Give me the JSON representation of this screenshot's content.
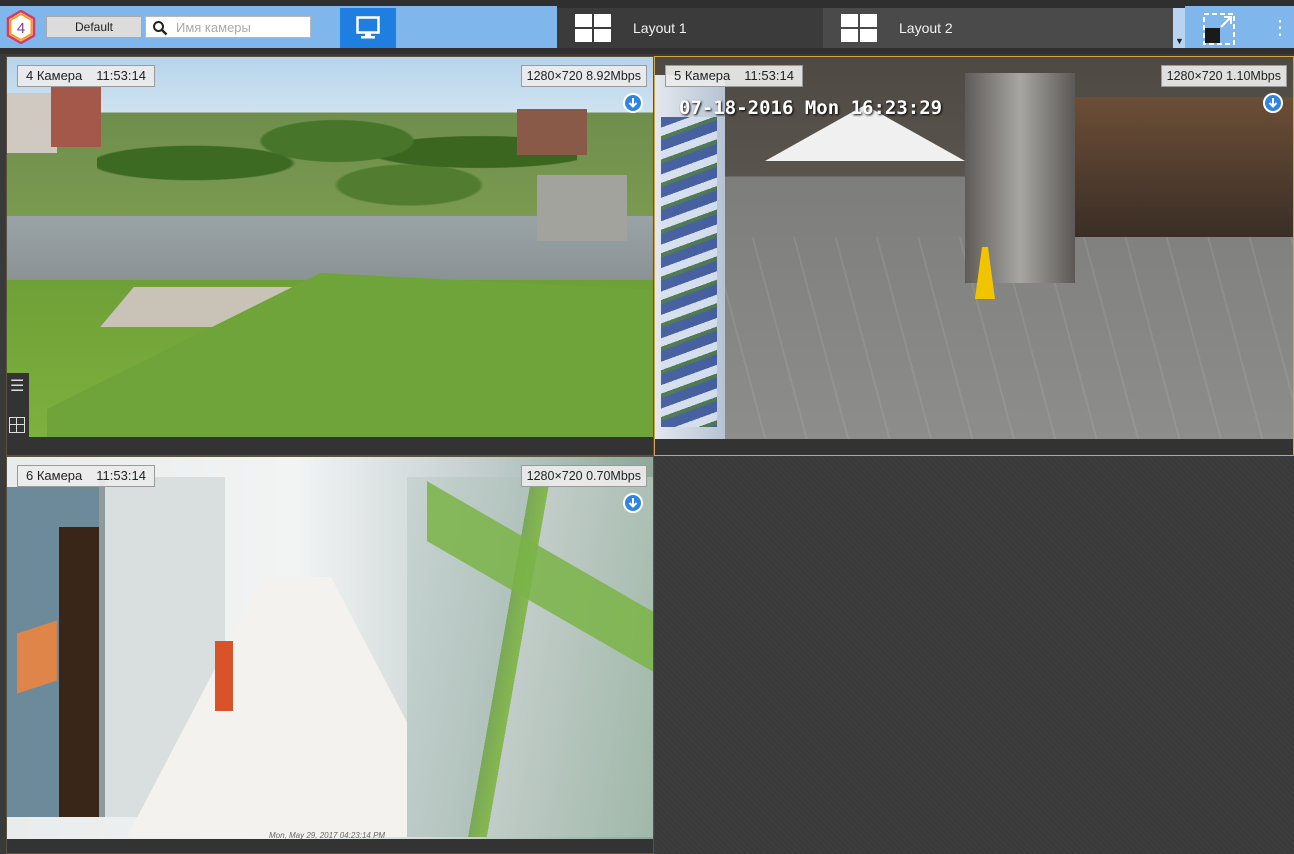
{
  "toolbar": {
    "logo_text": "4",
    "default_label": "Default",
    "search_placeholder": "Имя камеры",
    "search_value": "",
    "tabs": [
      {
        "label": "Layout 1"
      },
      {
        "label": "Layout 2"
      }
    ],
    "colors": {
      "accent": "#1f7fe0",
      "strip": "#7fb6ec",
      "active_border": "#d4a54a"
    },
    "icons": [
      "search-icon",
      "monitor-icon",
      "layout-grid-icon",
      "fullscreen-icon",
      "more-icon"
    ]
  },
  "cameras": [
    {
      "name": "4 Камера",
      "time": "11:53:14",
      "stream": "1280×720 8.92Mbps",
      "scene": "park"
    },
    {
      "name": "5 Камера",
      "time": "11:53:14",
      "stream": "1280×720 1.10Mbps",
      "scene": "lobby",
      "osd": "07-18-2016 Mon 16:23:29"
    },
    {
      "name": "6 Камера",
      "time": "11:53:14",
      "stream": "1280×720 0.70Mbps",
      "scene": "corridor",
      "osd": "Mon, May 29, 2017 04:23:14 PM"
    }
  ],
  "side_panel": {
    "icons": [
      "list-icon",
      "grid-icon"
    ]
  }
}
